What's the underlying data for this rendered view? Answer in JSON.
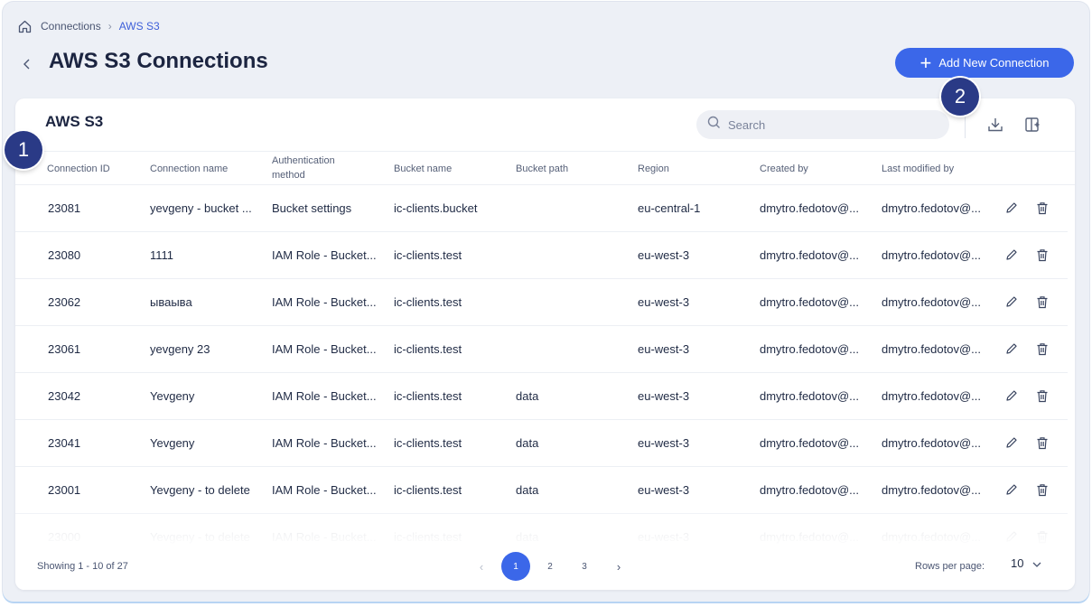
{
  "breadcrumb": {
    "parent": "Connections",
    "current": "AWS S3"
  },
  "page": {
    "title": "AWS S3 Connections",
    "add_button": "Add New Connection"
  },
  "card": {
    "title": "AWS S3",
    "search_placeholder": "Search"
  },
  "columns": [
    "Connection ID",
    "Connection name",
    "Authentication method",
    "Bucket name",
    "Bucket path",
    "Region",
    "Created by",
    "Last modified by"
  ],
  "rows": [
    {
      "id": "23081",
      "name": "yevgeny - bucket ...",
      "auth": "Bucket settings",
      "bucket": "ic-clients.bucket",
      "path": "",
      "region": "eu-central-1",
      "created": "dmytro.fedotov@...",
      "modified": "dmytro.fedotov@..."
    },
    {
      "id": "23080",
      "name": "1111",
      "auth": "IAM Role - Bucket...",
      "bucket": "ic-clients.test",
      "path": "",
      "region": "eu-west-3",
      "created": "dmytro.fedotov@...",
      "modified": "dmytro.fedotov@..."
    },
    {
      "id": "23062",
      "name": "ываыва",
      "auth": "IAM Role - Bucket...",
      "bucket": "ic-clients.test",
      "path": "",
      "region": "eu-west-3",
      "created": "dmytro.fedotov@...",
      "modified": "dmytro.fedotov@..."
    },
    {
      "id": "23061",
      "name": "yevgeny 23",
      "auth": "IAM Role - Bucket...",
      "bucket": "ic-clients.test",
      "path": "",
      "region": "eu-west-3",
      "created": "dmytro.fedotov@...",
      "modified": "dmytro.fedotov@..."
    },
    {
      "id": "23042",
      "name": "Yevgeny",
      "auth": "IAM Role - Bucket...",
      "bucket": "ic-clients.test",
      "path": "data",
      "region": "eu-west-3",
      "created": "dmytro.fedotov@...",
      "modified": "dmytro.fedotov@..."
    },
    {
      "id": "23041",
      "name": "Yevgeny",
      "auth": "IAM Role - Bucket...",
      "bucket": "ic-clients.test",
      "path": "data",
      "region": "eu-west-3",
      "created": "dmytro.fedotov@...",
      "modified": "dmytro.fedotov@..."
    },
    {
      "id": "23001",
      "name": "Yevgeny - to delete",
      "auth": "IAM Role - Bucket...",
      "bucket": "ic-clients.test",
      "path": "data",
      "region": "eu-west-3",
      "created": "dmytro.fedotov@...",
      "modified": "dmytro.fedotov@..."
    },
    {
      "id": "23000",
      "name": "Yevgeny - to delete",
      "auth": "IAM Role - Bucket...",
      "bucket": "ic-clients.test",
      "path": "data",
      "region": "eu-west-3",
      "created": "dmytro.fedotov@...",
      "modified": "dmytro.fedotov@..."
    }
  ],
  "footer": {
    "showing": "Showing 1 - 10 of 27",
    "pages": [
      "1",
      "2",
      "3"
    ],
    "current_page": "1",
    "rows_per_page_label": "Rows per page:",
    "rows_per_page": "10"
  },
  "markers": [
    "1",
    "2"
  ],
  "colors": {
    "accent": "#3b67e9",
    "marker": "#2a3a86",
    "background": "#edf0f6"
  }
}
